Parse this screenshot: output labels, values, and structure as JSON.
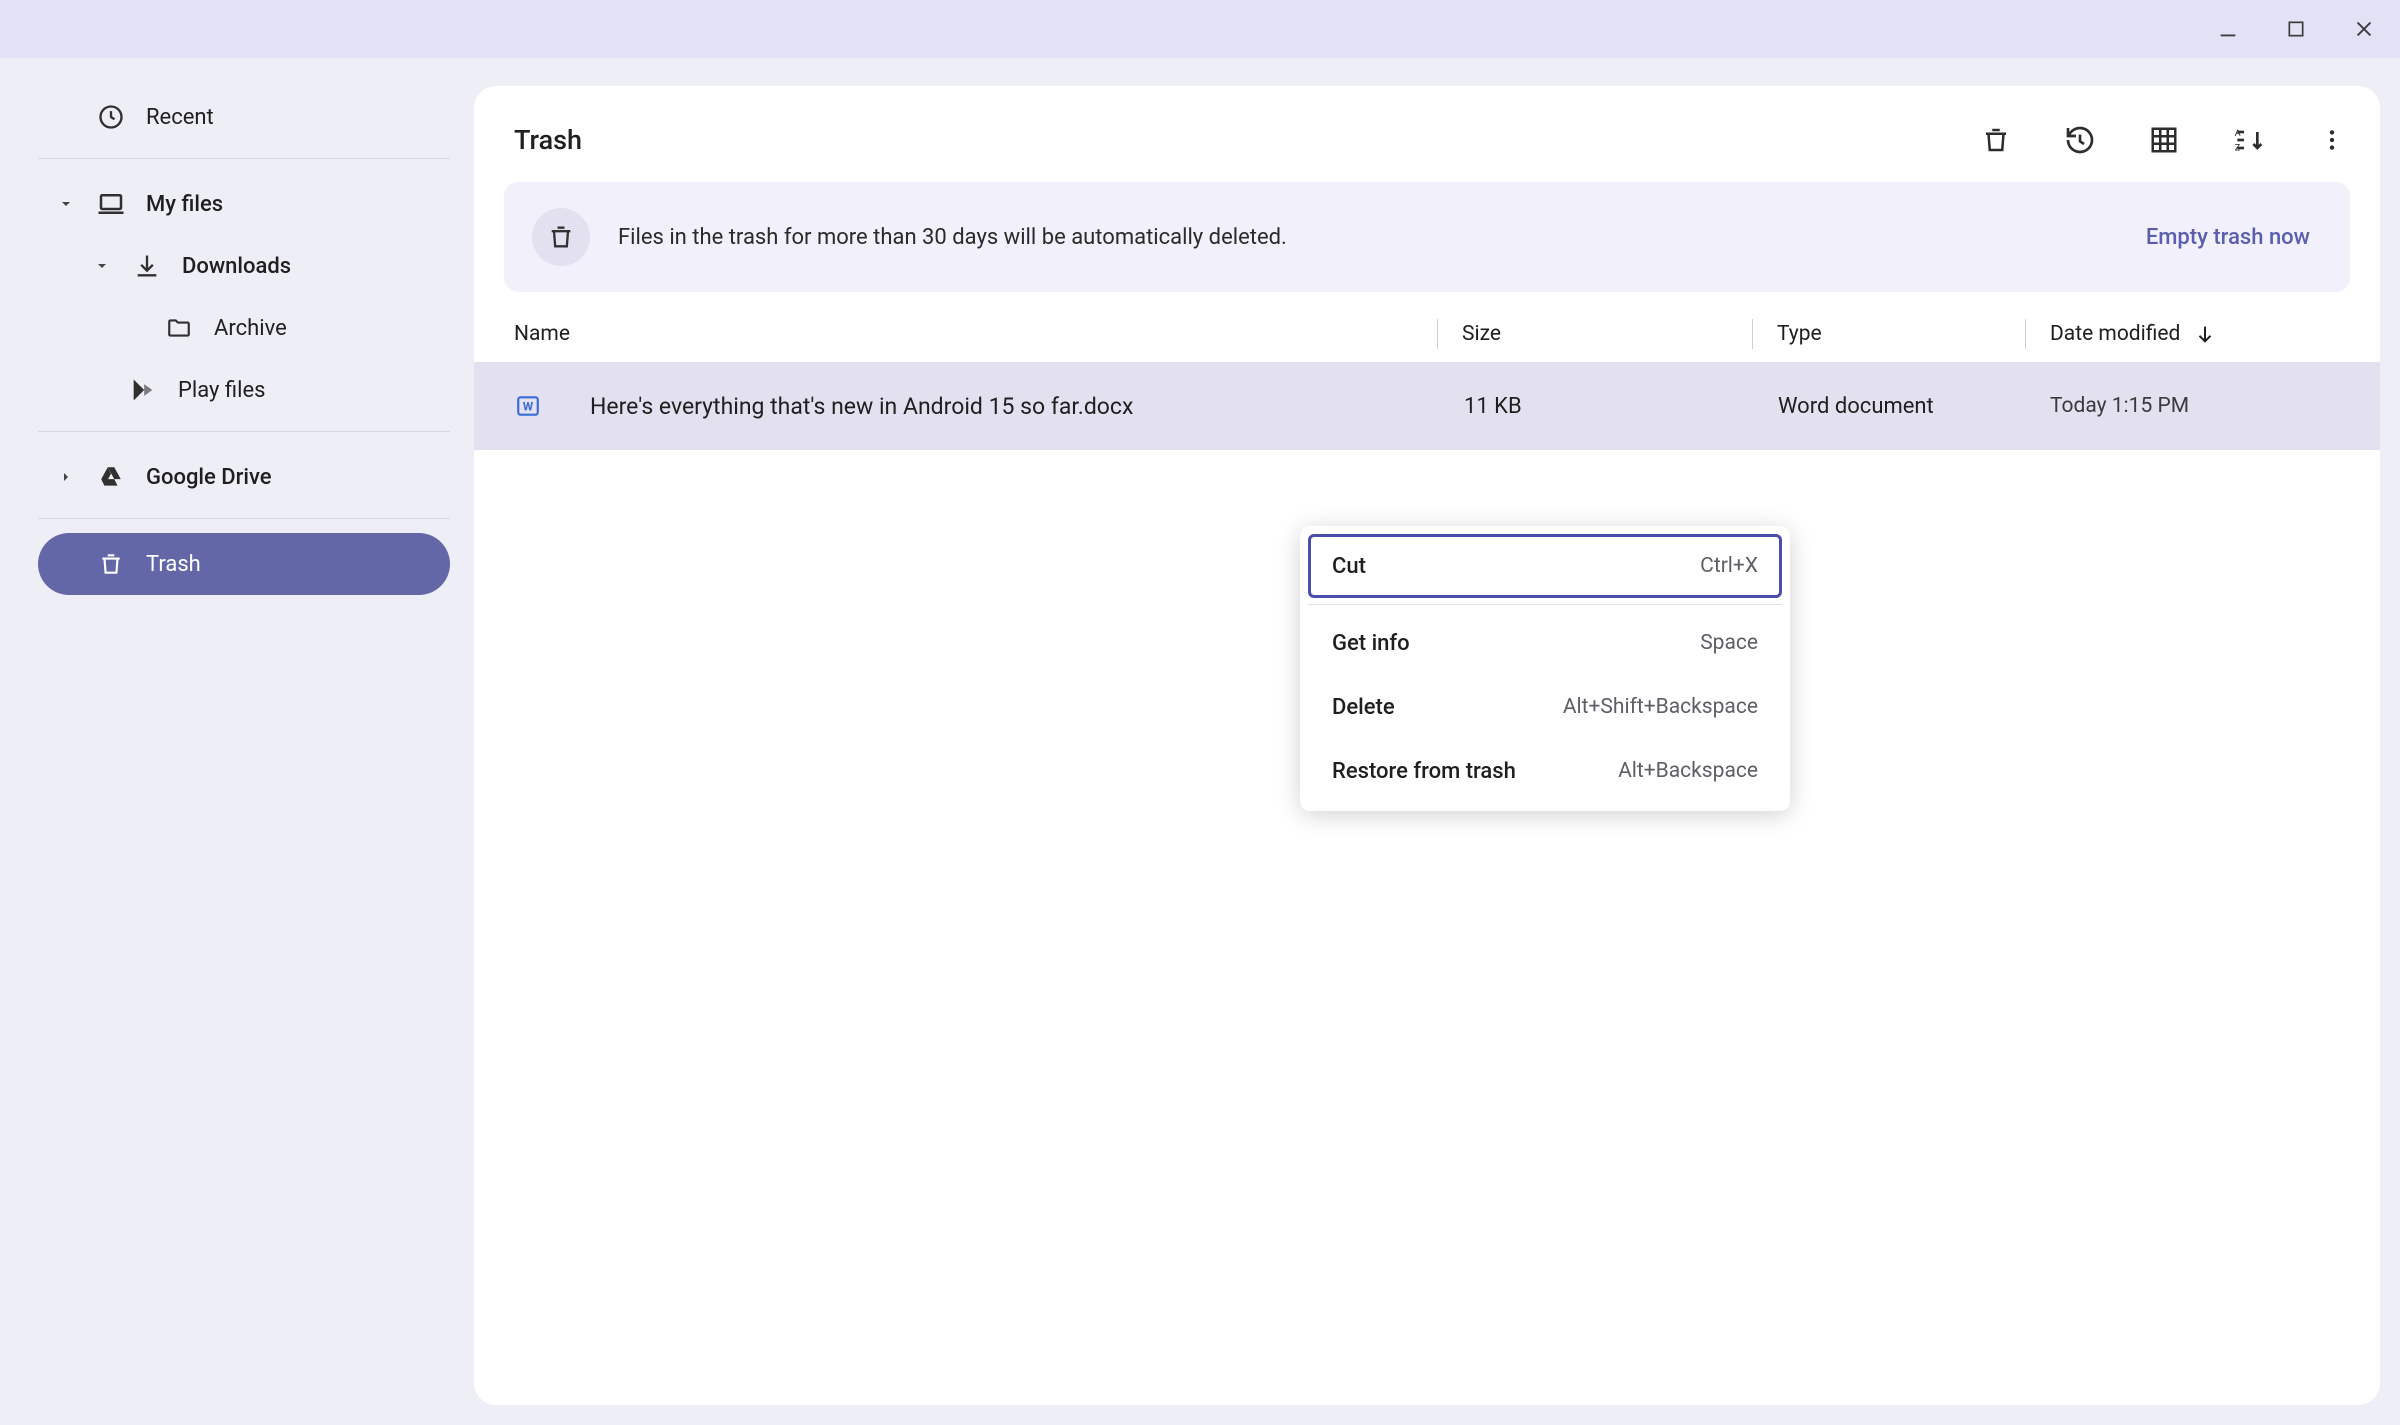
{
  "sidebar": {
    "recent": "Recent",
    "my_files": "My files",
    "downloads": "Downloads",
    "archive": "Archive",
    "play_files": "Play files",
    "google_drive": "Google Drive",
    "trash": "Trash"
  },
  "main": {
    "title": "Trash"
  },
  "banner": {
    "text": "Files in the trash for more than 30 days will be automatically deleted.",
    "button": "Empty trash now"
  },
  "columns": {
    "name": "Name",
    "size": "Size",
    "type": "Type",
    "date": "Date modified"
  },
  "row": {
    "name": "Here's everything that's new in Android 15 so far.docx",
    "size": "11 KB",
    "type": "Word document",
    "date": "Today 1:15 PM"
  },
  "menu": {
    "cut": {
      "label": "Cut",
      "shortcut": "Ctrl+X"
    },
    "get_info": {
      "label": "Get info",
      "shortcut": "Space"
    },
    "delete": {
      "label": "Delete",
      "shortcut": "Alt+Shift+Backspace"
    },
    "restore": {
      "label": "Restore from trash",
      "shortcut": "Alt+Backspace"
    }
  }
}
